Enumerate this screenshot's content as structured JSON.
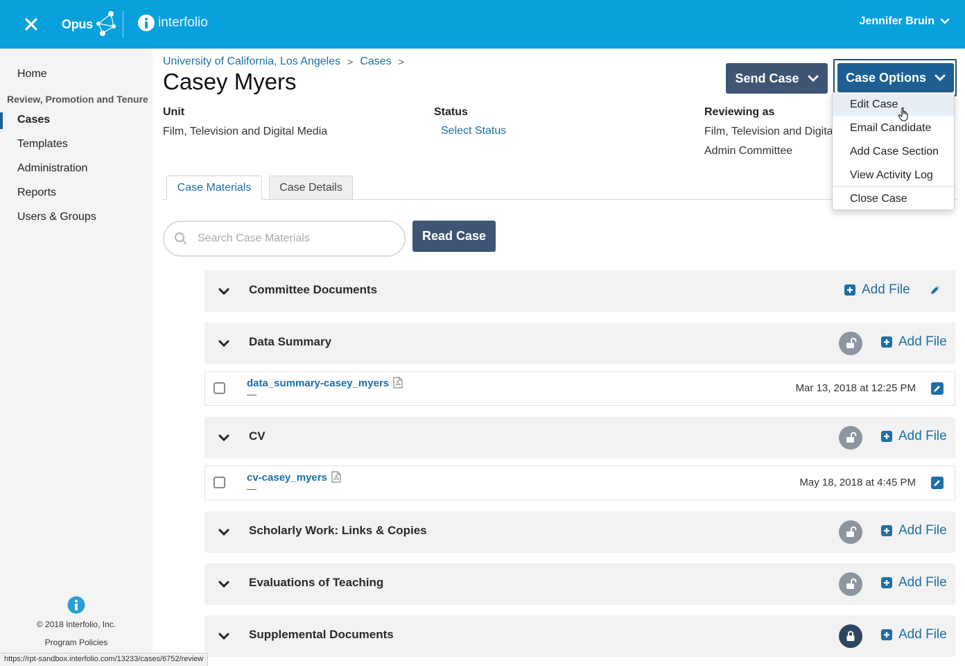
{
  "topbar": {
    "opus_label": "Opus",
    "interfolio_label": "interfolio",
    "user_name": "Jennifer Bruin"
  },
  "sidebar": {
    "home": "Home",
    "section_label": "Review, Promotion and Tenure",
    "items": [
      "Cases",
      "Templates",
      "Administration",
      "Reports",
      "Users & Groups"
    ],
    "copyright": "© 2018 Interfolio, Inc.",
    "policies": "Program Policies"
  },
  "breadcrumb": {
    "org": "University of California, Los Angeles",
    "cases": "Cases",
    "sep": ">"
  },
  "page": {
    "title": "Casey Myers"
  },
  "actions": {
    "send_case": "Send Case",
    "case_options": "Case Options"
  },
  "dropdown": {
    "items": [
      "Edit Case",
      "Email Candidate",
      "Add Case Section",
      "View Activity Log",
      "Close Case"
    ]
  },
  "meta": {
    "unit_label": "Unit",
    "unit_value": "Film, Television and Digital Media",
    "status_label": "Status",
    "status_value": "Select Status",
    "reviewing_label": "Reviewing as",
    "reviewing_value_1": "Film, Television and Digita",
    "reviewing_value_2": "Admin Committee"
  },
  "tabs": {
    "materials": "Case Materials",
    "details": "Case Details"
  },
  "search": {
    "placeholder": "Search Case Materials"
  },
  "read_case": "Read Case",
  "add_file_label": "Add File",
  "sections": [
    {
      "title": "Committee Documents"
    },
    {
      "title": "Data Summary"
    },
    {
      "title": "CV"
    },
    {
      "title": "Scholarly Work: Links & Copies"
    },
    {
      "title": "Evaluations of Teaching"
    },
    {
      "title": "Supplemental Documents"
    }
  ],
  "files": [
    {
      "name": "data_summary-casey_myers",
      "sub": "—",
      "date": "Mar 13, 2018 at 12:25 PM"
    },
    {
      "name": "cv-casey_myers",
      "sub": "—",
      "date": "May 18, 2018 at 4:45 PM"
    }
  ],
  "status_url": "https://rpt-sandbox.interfolio.com/13233/cases/6752/review",
  "colors": {
    "topbar": "#09a1dc",
    "primary_button": "#3e5573",
    "active_button": "#1d5f93",
    "link": "#1d6fa5"
  }
}
